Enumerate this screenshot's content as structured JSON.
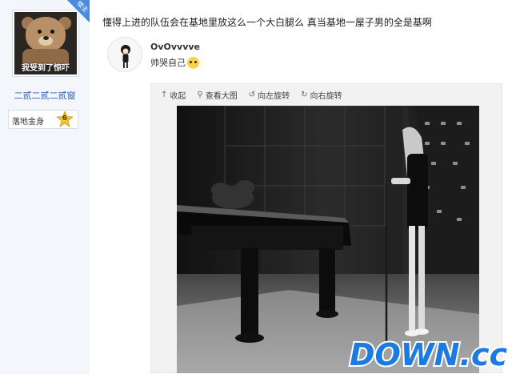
{
  "sidebar": {
    "avatar_caption": "我受到了惊吓",
    "corner_badge": "楼主",
    "username": "二贰二贰二贰窗",
    "level_name": "落地金身",
    "level_number": "6"
  },
  "post": {
    "title": "懂得上进的队伍会在基地里放这么一个大白腿么 真当基地一屋子男的全是基啊"
  },
  "reply": {
    "username": "OvOvvvve",
    "text": "帅哭自己"
  },
  "viewer": {
    "toolbar": [
      {
        "icon": "collapse-icon",
        "glyph": "↑",
        "label": "收起"
      },
      {
        "icon": "search-icon",
        "glyph": "⚲",
        "label": "查看大图"
      },
      {
        "icon": "rotate-left-icon",
        "glyph": "↺",
        "label": "向左旋转"
      },
      {
        "icon": "rotate-right-icon",
        "glyph": "↻",
        "label": "向右旋转"
      }
    ]
  },
  "watermark": "DOWN.cc",
  "colors": {
    "sidebar_bg": "#f3f6fb",
    "link_blue": "#2d64b3",
    "badge_blue": "#4a8be0",
    "watermark_blue": "#1d7be0",
    "watermark_orange": "#ff9b1a"
  }
}
